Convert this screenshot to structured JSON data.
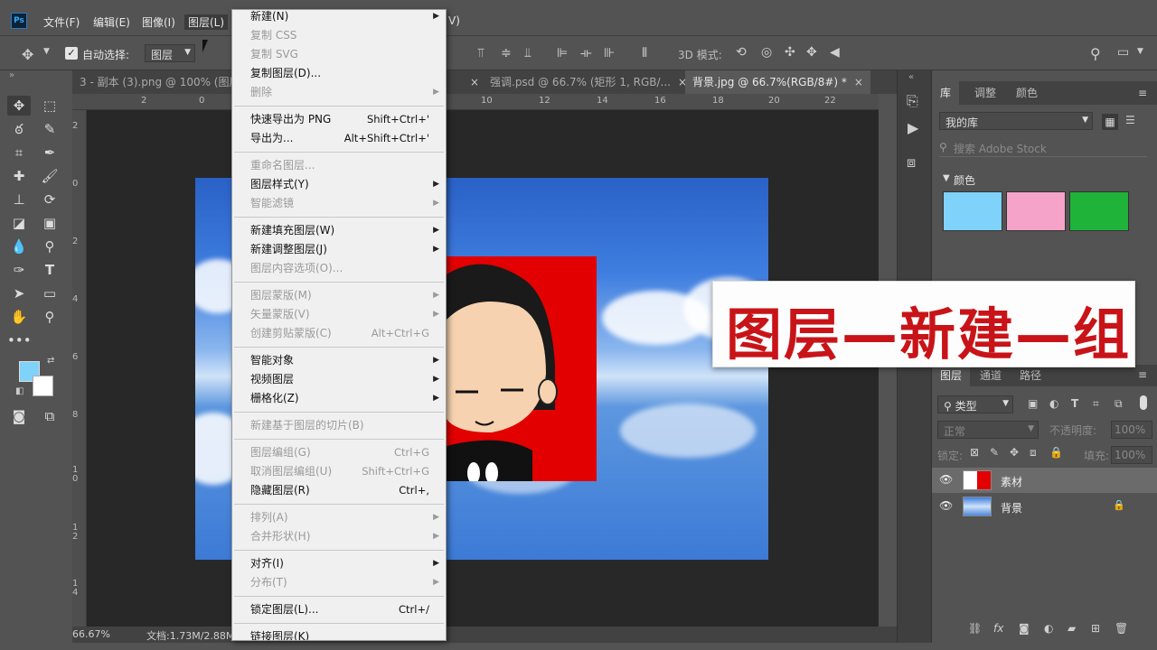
{
  "menubar": {
    "app_icon": "Ps",
    "items": [
      "文件(F)",
      "编辑(E)",
      "图像(I)",
      "图层(L)"
    ],
    "trailing": "V)"
  },
  "options": {
    "auto_select_label": "自动选择:",
    "auto_select_value": "图层",
    "mode_3d_label": "3D 模式:"
  },
  "tabs": [
    {
      "label": "3 - 副本 (3).png @ 100% (图层",
      "active": false
    },
    {
      "label": "强调.psd @ 66.7% (矩形 1, RGB/...",
      "active": false
    },
    {
      "label": "背景.jpg @ 66.7%(RGB/8#) *",
      "active": true
    }
  ],
  "ruler_h": [
    "2",
    "0",
    "10",
    "12",
    "14",
    "16",
    "18",
    "20",
    "22"
  ],
  "ruler_v": [
    "2",
    "0",
    "2",
    "4",
    "6",
    "8",
    "1\n0",
    "1\n2",
    "1\n4"
  ],
  "status": {
    "zoom": "66.67%",
    "doc": "文档:1.73M/2.88M"
  },
  "menu": {
    "items": [
      {
        "label": "新建(N)",
        "shortcut": "",
        "arrow": true,
        "disabled": false
      },
      {
        "label": "复制 CSS",
        "shortcut": "",
        "arrow": false,
        "disabled": true
      },
      {
        "label": "复制 SVG",
        "shortcut": "",
        "arrow": false,
        "disabled": true
      },
      {
        "label": "复制图层(D)...",
        "shortcut": "",
        "arrow": false,
        "disabled": false
      },
      {
        "label": "删除",
        "shortcut": "",
        "arrow": true,
        "disabled": true
      },
      {
        "sep": true
      },
      {
        "label": "快速导出为 PNG",
        "shortcut": "Shift+Ctrl+'",
        "arrow": false,
        "disabled": false
      },
      {
        "label": "导出为...",
        "shortcut": "Alt+Shift+Ctrl+'",
        "arrow": false,
        "disabled": false
      },
      {
        "sep": true
      },
      {
        "label": "重命名图层...",
        "shortcut": "",
        "arrow": false,
        "disabled": true
      },
      {
        "label": "图层样式(Y)",
        "shortcut": "",
        "arrow": true,
        "disabled": false
      },
      {
        "label": "智能滤镜",
        "shortcut": "",
        "arrow": true,
        "disabled": true
      },
      {
        "sep": true
      },
      {
        "label": "新建填充图层(W)",
        "shortcut": "",
        "arrow": true,
        "disabled": false
      },
      {
        "label": "新建调整图层(J)",
        "shortcut": "",
        "arrow": true,
        "disabled": false
      },
      {
        "label": "图层内容选项(O)...",
        "shortcut": "",
        "arrow": false,
        "disabled": true
      },
      {
        "sep": true
      },
      {
        "label": "图层蒙版(M)",
        "shortcut": "",
        "arrow": true,
        "disabled": true
      },
      {
        "label": "矢量蒙版(V)",
        "shortcut": "",
        "arrow": true,
        "disabled": true
      },
      {
        "label": "创建剪贴蒙版(C)",
        "shortcut": "Alt+Ctrl+G",
        "arrow": false,
        "disabled": true
      },
      {
        "sep": true
      },
      {
        "label": "智能对象",
        "shortcut": "",
        "arrow": true,
        "disabled": false
      },
      {
        "label": "视频图层",
        "shortcut": "",
        "arrow": true,
        "disabled": false
      },
      {
        "label": "栅格化(Z)",
        "shortcut": "",
        "arrow": true,
        "disabled": false
      },
      {
        "sep": true
      },
      {
        "label": "新建基于图层的切片(B)",
        "shortcut": "",
        "arrow": false,
        "disabled": true
      },
      {
        "sep": true
      },
      {
        "label": "图层编组(G)",
        "shortcut": "Ctrl+G",
        "arrow": false,
        "disabled": true
      },
      {
        "label": "取消图层编组(U)",
        "shortcut": "Shift+Ctrl+G",
        "arrow": false,
        "disabled": true
      },
      {
        "label": "隐藏图层(R)",
        "shortcut": "Ctrl+,",
        "arrow": false,
        "disabled": false
      },
      {
        "sep": true
      },
      {
        "label": "排列(A)",
        "shortcut": "",
        "arrow": true,
        "disabled": true
      },
      {
        "label": "合并形状(H)",
        "shortcut": "",
        "arrow": true,
        "disabled": true
      },
      {
        "sep": true
      },
      {
        "label": "对齐(I)",
        "shortcut": "",
        "arrow": true,
        "disabled": false
      },
      {
        "label": "分布(T)",
        "shortcut": "",
        "arrow": true,
        "disabled": true
      },
      {
        "sep": true
      },
      {
        "label": "锁定图层(L)...",
        "shortcut": "Ctrl+/",
        "arrow": false,
        "disabled": false
      },
      {
        "sep": true
      },
      {
        "label": "链接图层(K)",
        "shortcut": "",
        "arrow": false,
        "disabled": false
      }
    ]
  },
  "panels": {
    "library_tabs": [
      "库",
      "调整",
      "颜色"
    ],
    "library_select": "我的库",
    "stock_search_placeholder": "搜索 Adobe Stock",
    "color_section": "颜色",
    "swatches": [
      "#7fd2fa",
      "#f5a3c9",
      "#1fb33a"
    ],
    "layer_tabs": [
      "图层",
      "通道",
      "路径"
    ],
    "filter_kind": "类型",
    "blend_mode": "正常",
    "opacity_label": "不透明度:",
    "opacity_value": "100%",
    "lock_label": "锁定:",
    "fill_label": "填充:",
    "fill_value": "100%",
    "layers": [
      {
        "name": "素材",
        "selected": true,
        "locked": false
      },
      {
        "name": "背景",
        "selected": false,
        "locked": true
      }
    ]
  },
  "caption": "图层—新建—组",
  "colors": {
    "fg": "#7fd2fa",
    "bg": "#ffffff",
    "caption": "#c81418"
  }
}
